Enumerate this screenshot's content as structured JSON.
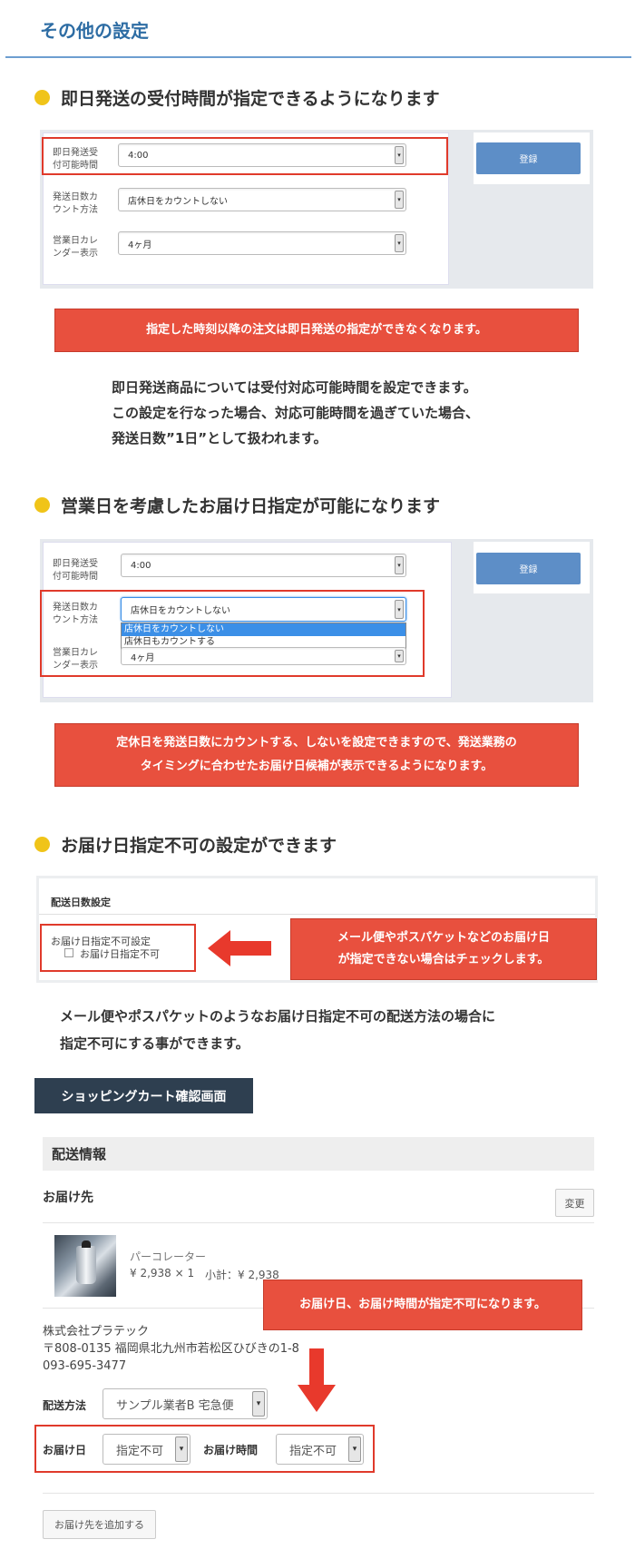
{
  "page_title": "その他の設定",
  "section1": {
    "heading": "即日発送の受付時間が指定できるようになります",
    "form": {
      "rows": [
        {
          "label": "即日発送受付可能時間",
          "value": "4:00"
        },
        {
          "label": "発送日数カウント方法",
          "value": "店休日をカウントしない"
        },
        {
          "label": "営業日カレンダー表示",
          "value": "4ヶ月"
        }
      ],
      "submit_label": "登録"
    },
    "banner": "指定した時刻以降の注文は即日発送の指定ができなくなります。",
    "paragraph": [
      "即日発送商品については受付対応可能時間を設定できます。",
      "この設定を行なった場合、対応可能時間を過ぎていた場合、",
      "発送日数”1日”として扱われます。"
    ]
  },
  "section2": {
    "heading": "営業日を考慮したお届け日指定が可能になります",
    "form": {
      "rows": [
        {
          "label": "即日発送受付可能時間",
          "value": "4:00"
        },
        {
          "label": "発送日数カウント方法",
          "value": "店休日をカウントしない"
        },
        {
          "label": "営業日カレンダー表示",
          "value": "4ヶ月"
        }
      ],
      "dropdown_options": [
        "店休日をカウントしない",
        "店休日もカウントする"
      ],
      "submit_label": "登録"
    },
    "banner": [
      "定休日を発送日数にカウントする、しないを設定できますので、発送業務の",
      "タイミングに合わせたお届け日候補が表示できるようになります。"
    ]
  },
  "section3": {
    "heading": "お届け日指定不可の設定ができます",
    "panel_title": "配送日数設定",
    "setting_label": "お届け日指定不可設定",
    "checkbox_label": "お届け日指定不可",
    "checkbox_checked": false,
    "callout": [
      "メール便やポスパケットなどのお届け日",
      "が指定できない場合はチェックします。"
    ],
    "paragraph": [
      "メール便やポスパケットのようなお届け日指定不可の配送方法の場合に",
      "指定不可にする事ができます。"
    ]
  },
  "cart": {
    "heading": "ショッピングカート確認画面",
    "section_title": "配送情報",
    "destination_label": "お届け先",
    "change_label": "変更",
    "product": {
      "name": "パーコレーター",
      "price_qty": "¥ 2,938 × 1",
      "subtotal": "小計：¥ 2,938"
    },
    "callout": "お届け日、お届け時間が指定不可になります。",
    "address": {
      "company": "株式会社プラテック",
      "address": "〒808-0135 福岡県北九州市若松区ひびきの1-8",
      "phone": "093-695-3477"
    },
    "shipping_method_label": "配送方法",
    "shipping_method_value": "サンプル業者B 宅急便",
    "delivery_date_label": "お届け日",
    "delivery_date_value": "指定不可",
    "delivery_time_label": "お届け時間",
    "delivery_time_value": "指定不可",
    "add_destination_label": "お届け先を追加する"
  },
  "colors": {
    "accent_blue": "#2e6da4",
    "bullet_yellow": "#f0c419",
    "banner_red": "#e8503e",
    "button_blue": "#5d8ec7",
    "heading_dark": "#2e3f50"
  }
}
